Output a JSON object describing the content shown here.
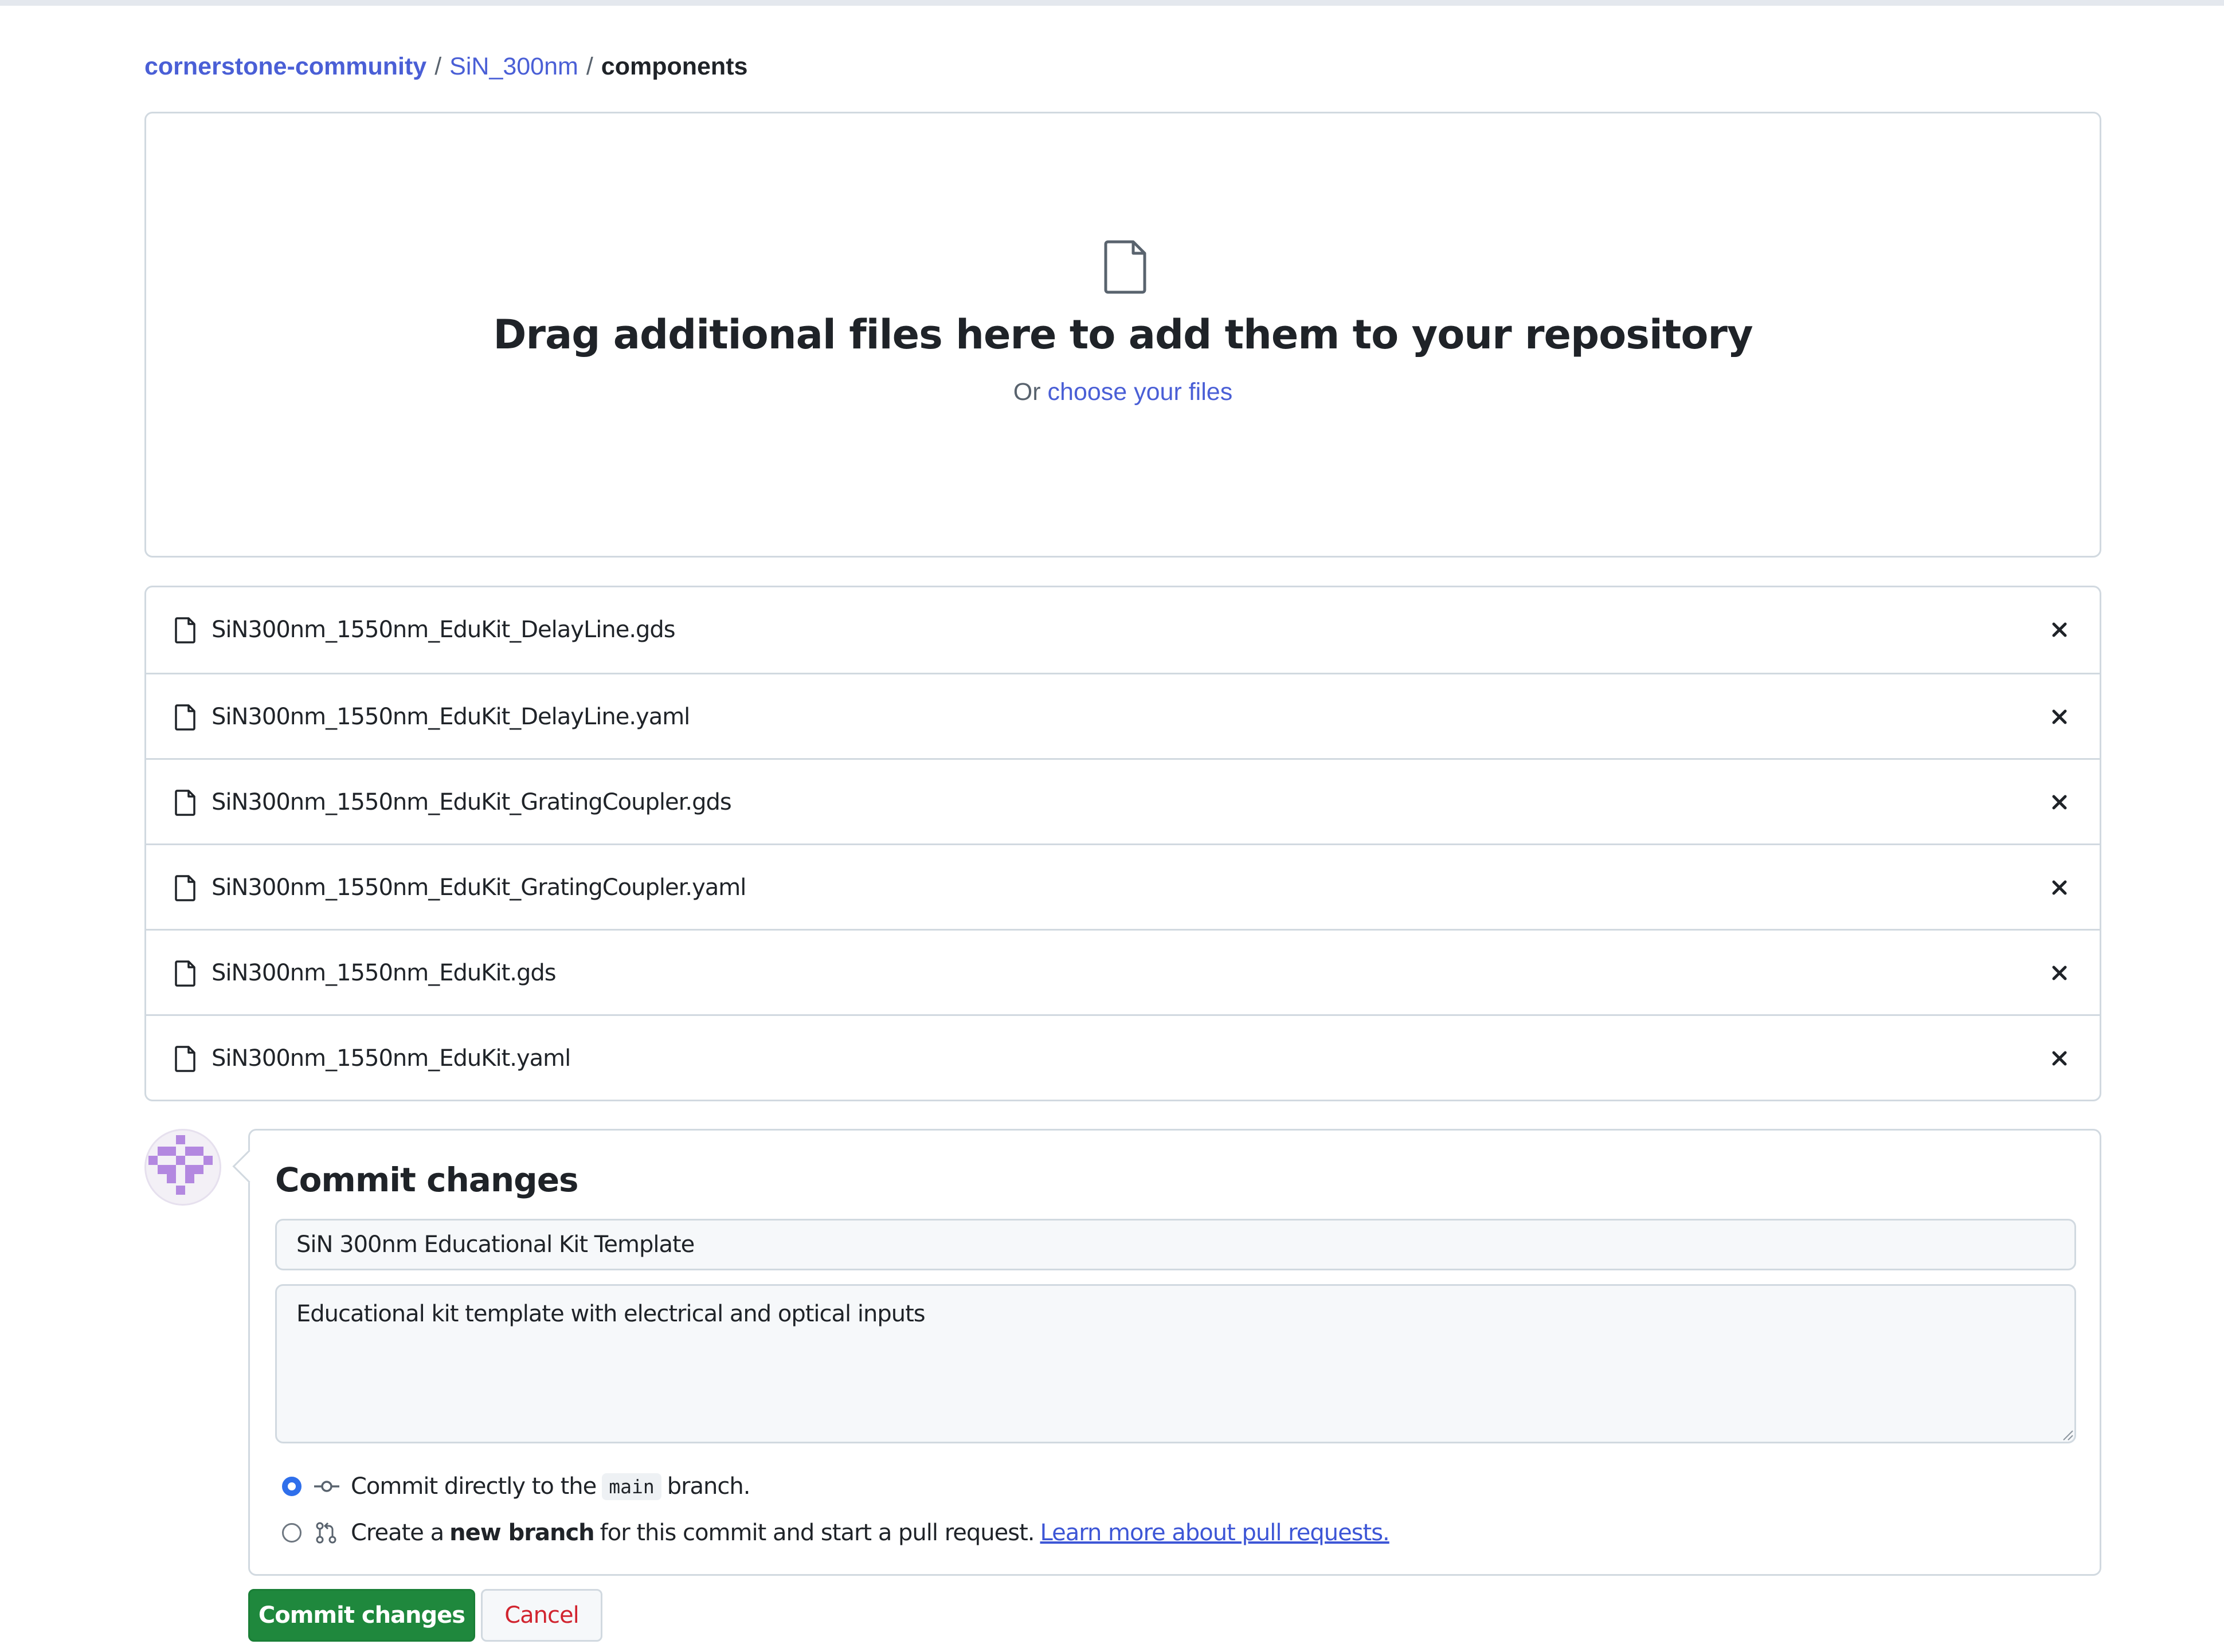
{
  "breadcrumb": {
    "owner": "cornerstone-community",
    "sep1": "/",
    "repo": "SiN_300nm",
    "sep2": "/",
    "folder": "components"
  },
  "dropzone": {
    "icon": "file-icon",
    "title": "Drag additional files here to add them to your repository",
    "or_text": "Or",
    "choose_link": "choose your files"
  },
  "files": [
    {
      "name": "SiN300nm_1550nm_EduKit_DelayLine.gds"
    },
    {
      "name": "SiN300nm_1550nm_EduKit_DelayLine.yaml"
    },
    {
      "name": "SiN300nm_1550nm_EduKit_GratingCoupler.gds"
    },
    {
      "name": "SiN300nm_1550nm_EduKit_GratingCoupler.yaml"
    },
    {
      "name": "SiN300nm_1550nm_EduKit.gds"
    },
    {
      "name": "SiN300nm_1550nm_EduKit.yaml"
    }
  ],
  "commit": {
    "heading": "Commit changes",
    "summary_value": "SiN 300nm Educational Kit Template",
    "description_value": "Educational kit template with electrical and optical inputs",
    "option_direct": {
      "before": "Commit directly to the",
      "branch": "main",
      "after": "branch."
    },
    "option_new_branch": {
      "before": "Create a",
      "bold": "new branch",
      "after": "for this commit and start a pull request.",
      "link": "Learn more about pull requests."
    },
    "selected_option": "direct"
  },
  "buttons": {
    "commit": "Commit changes",
    "cancel": "Cancel"
  },
  "colors": {
    "link": "#4a5fd6",
    "primary_button": "#1f883d",
    "cancel_text": "#d1242f",
    "radio_selected": "#2f6feb",
    "avatar_purple": "#b388e0"
  }
}
